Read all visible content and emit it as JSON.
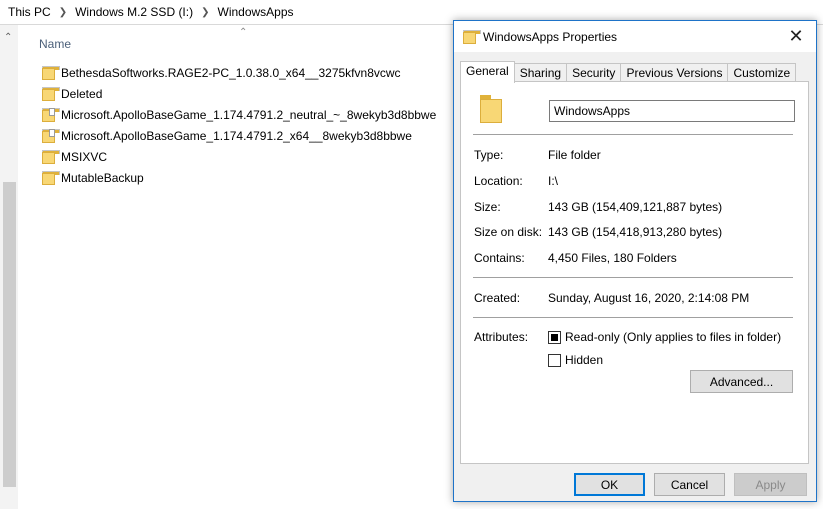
{
  "breadcrumb": [
    "This PC",
    "Windows M.2 SSD (I:)",
    "WindowsApps"
  ],
  "file_list": {
    "column_header": "Name",
    "items": [
      {
        "name": "BethesdaSoftworks.RAGE2-PC_1.0.38.0_x64__3275kfvn8vcwc",
        "icon": "folder-icon"
      },
      {
        "name": "Deleted",
        "icon": "folder-icon"
      },
      {
        "name": "Microsoft.ApolloBaseGame_1.174.4791.2_neutral_~_8wekyb3d8bbwe",
        "icon": "folder-doc-icon"
      },
      {
        "name": "Microsoft.ApolloBaseGame_1.174.4791.2_x64__8wekyb3d8bbwe",
        "icon": "folder-doc-icon"
      },
      {
        "name": "MSIXVC",
        "icon": "folder-icon"
      },
      {
        "name": "MutableBackup",
        "icon": "folder-icon"
      }
    ]
  },
  "dialog": {
    "title": "WindowsApps Properties",
    "tabs": [
      "General",
      "Sharing",
      "Security",
      "Previous Versions",
      "Customize"
    ],
    "active_tab": "General",
    "folder_name": "WindowsApps",
    "properties": {
      "type": {
        "label": "Type:",
        "value": "File folder"
      },
      "location": {
        "label": "Location:",
        "value": "I:\\"
      },
      "size": {
        "label": "Size:",
        "value": "143 GB (154,409,121,887 bytes)"
      },
      "size_on_disk": {
        "label": "Size on disk:",
        "value": "143 GB (154,418,913,280 bytes)"
      },
      "contains": {
        "label": "Contains:",
        "value": "4,450 Files, 180 Folders"
      },
      "created": {
        "label": "Created:",
        "value": "Sunday, August 16, 2020, 2:14:08 PM"
      }
    },
    "attributes": {
      "label": "Attributes:",
      "read_only": {
        "label": "Read-only (Only applies to files in folder)",
        "state": "indeterminate"
      },
      "hidden": {
        "label": "Hidden",
        "state": "unchecked"
      },
      "advanced_button": "Advanced..."
    },
    "buttons": {
      "ok": "OK",
      "cancel": "Cancel",
      "apply": "Apply"
    }
  },
  "colors": {
    "accent": "#0078d7",
    "folder": "#f8d775",
    "dialog_border": "#1e73c8"
  }
}
